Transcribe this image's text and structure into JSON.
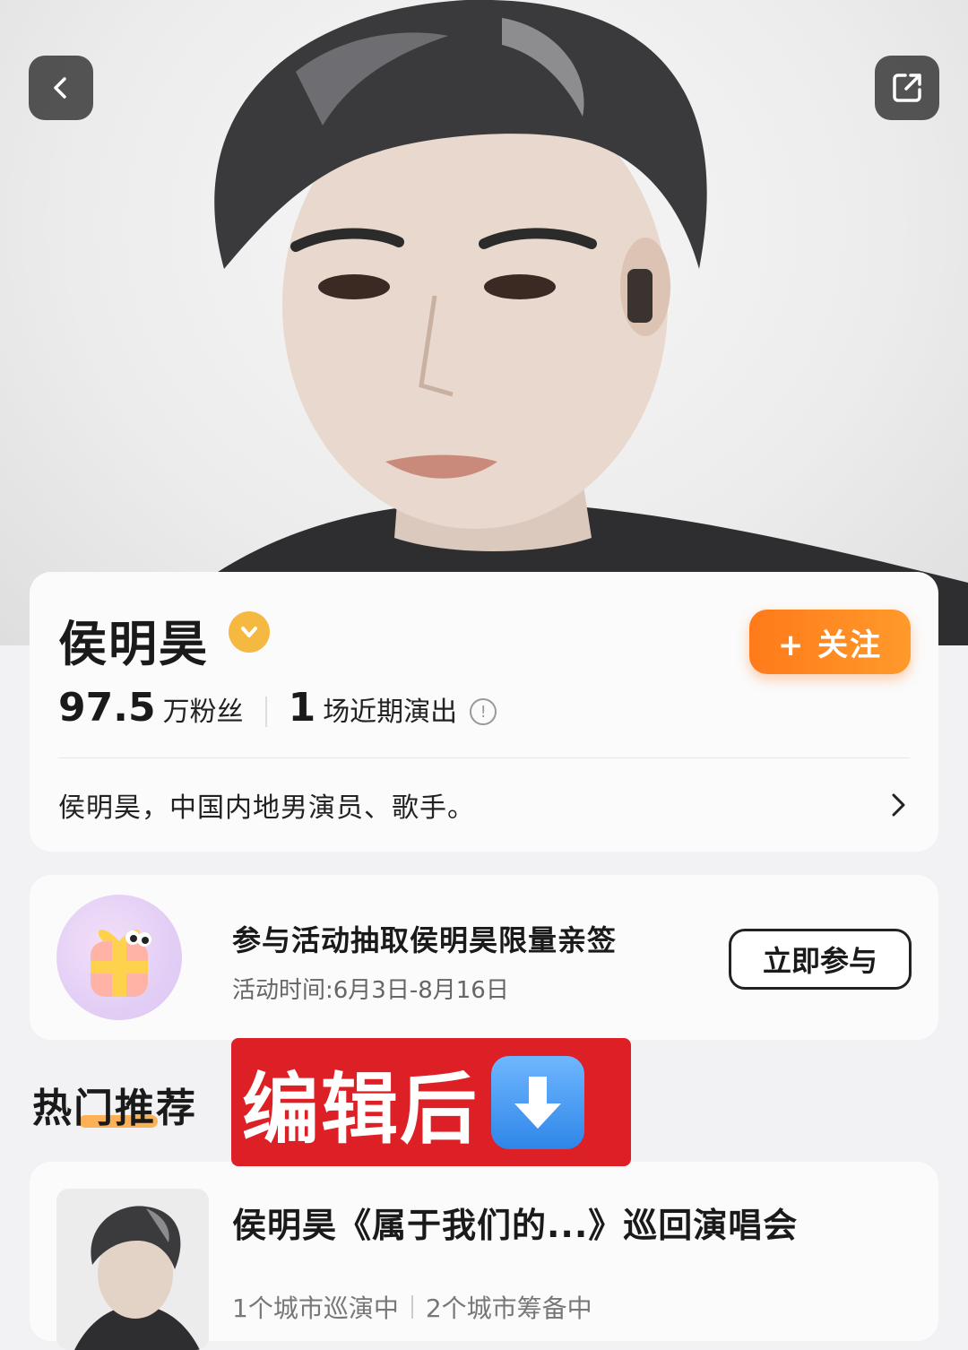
{
  "hero": {
    "back_icon": "chevron-left-icon",
    "share_icon": "share-icon"
  },
  "profile": {
    "name": "侯明昊",
    "verified_icon": "verified-badge-icon",
    "follow_label": "+ 关注",
    "fans_count": "97.5",
    "fans_unit": "万粉丝",
    "shows_count": "1",
    "shows_unit": "场近期演出",
    "bio": "侯明昊，中国内地男演员、歌手。"
  },
  "activity": {
    "title": "参与活动抽取侯明昊限量亲签",
    "time": "活动时间:6月3日-8月16日",
    "join_label": "立即参与"
  },
  "section": {
    "title": "热门推荐"
  },
  "overlay": {
    "edit_text": "编辑后",
    "arrow_icon": "down-arrow-emoji-icon"
  },
  "concert": {
    "title": "侯明昊《属于我们的...》巡回演唱会",
    "touring": "1个城市巡演中",
    "preparing": "2个城市筹备中"
  },
  "colors": {
    "accent": "#ff7a1a",
    "badge": "#f5b942",
    "overlay_red": "#dd1f26"
  }
}
